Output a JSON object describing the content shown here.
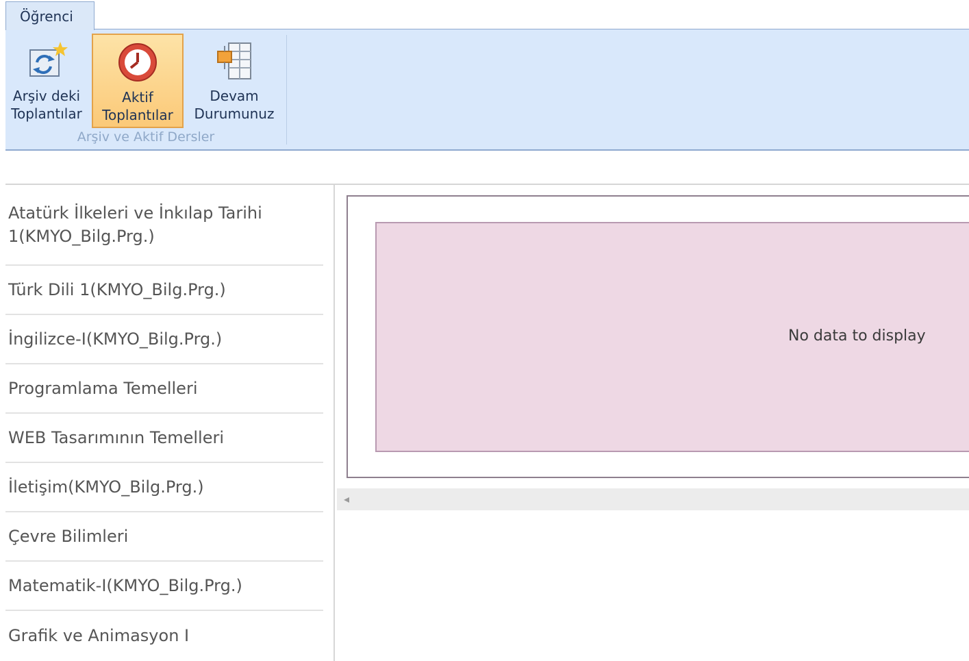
{
  "ribbon": {
    "tab_label": "Öğrenci",
    "buttons": [
      {
        "line1": "Arşiv deki",
        "line2": "Toplantılar",
        "icon": "archive-refresh-icon"
      },
      {
        "line1": "Aktif",
        "line2": "Toplantılar",
        "icon": "clock-icon",
        "active": true
      },
      {
        "line1": "Devam",
        "line2": "Durumunuz",
        "icon": "attendance-sheet-icon"
      }
    ],
    "group_label": "Arşiv ve Aktif Dersler"
  },
  "courses": [
    {
      "line1": "Atatürk İlkeleri ve İnkılap Tarihi",
      "line2": "1(KMYO_Bilg.Prg.)"
    },
    {
      "label": "Türk Dili 1(KMYO_Bilg.Prg.)"
    },
    {
      "label": "İngilizce-I(KMYO_Bilg.Prg.)"
    },
    {
      "label": "Programlama Temelleri"
    },
    {
      "label": "WEB Tasarımının Temelleri"
    },
    {
      "label": "İletişim(KMYO_Bilg.Prg.)"
    },
    {
      "label": "Çevre Bilimleri"
    },
    {
      "label": "Matematik-I(KMYO_Bilg.Prg.)"
    },
    {
      "label": "Grafik ve Animasyon I"
    }
  ],
  "grid": {
    "empty_text": "No data to display",
    "scroll_left_glyph": "◂"
  },
  "colors": {
    "ribbon_bg": "#d9e8fb",
    "active_button": "#fbc978",
    "empty_panel": "#eed8e4"
  }
}
